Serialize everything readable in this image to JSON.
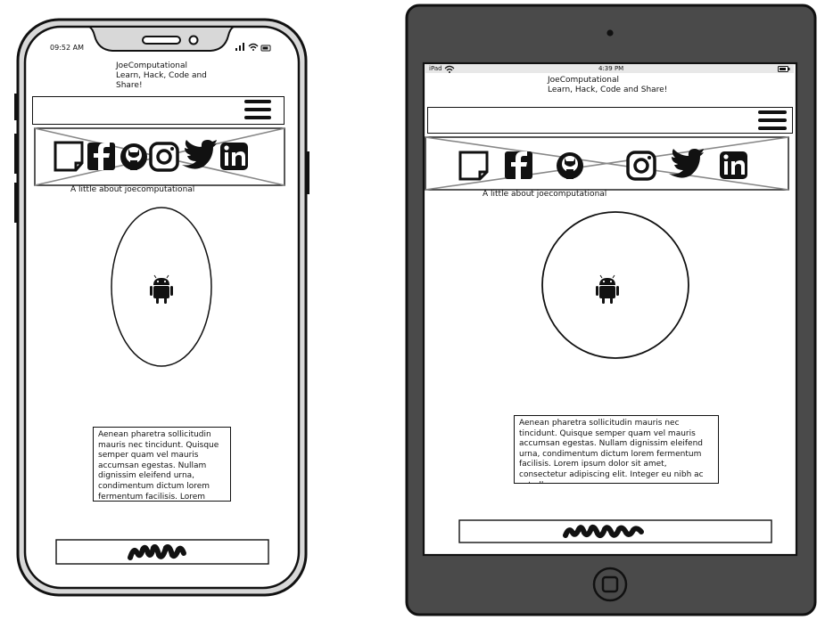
{
  "phone": {
    "status_time": "09:52 AM",
    "header_title": "JoeComputational\nLearn, Hack, Code and\nShare!",
    "about_label": "A little about joecomputational",
    "paragraph": "Aenean pharetra sollicitudin mauris nec tincidunt. Quisque semper quam vel mauris accumsan egestas. Nullam dignissim eleifend urna, condimentum dictum lorem fermentum facilisis. Lorem ipsum"
  },
  "tablet": {
    "status_device": "iPad",
    "status_time": "4:39 PM",
    "header_title": "JoeComputational\nLearn, Hack, Code and Share!",
    "about_label": "A little about joecomputational",
    "paragraph": "Aenean pharetra sollicitudin mauris nec tincidunt. Quisque semper quam vel mauris accumsan egestas. Nullam dignissim eleifend urna, condimentum dictum lorem fermentum facilisis. Lorem ipsum dolor sit amet, consectetur adipiscing elit. Integer eu nibh ac est ullamcorper"
  },
  "social_icons": [
    "note-icon",
    "facebook-icon",
    "github-icon",
    "instagram-icon",
    "twitter-icon",
    "linkedin-icon"
  ],
  "colors": {
    "device_frame": "#444444",
    "outline": "#111111",
    "bezel_tablet": "#4a4a4a",
    "screen_bg": "#ffffff"
  }
}
